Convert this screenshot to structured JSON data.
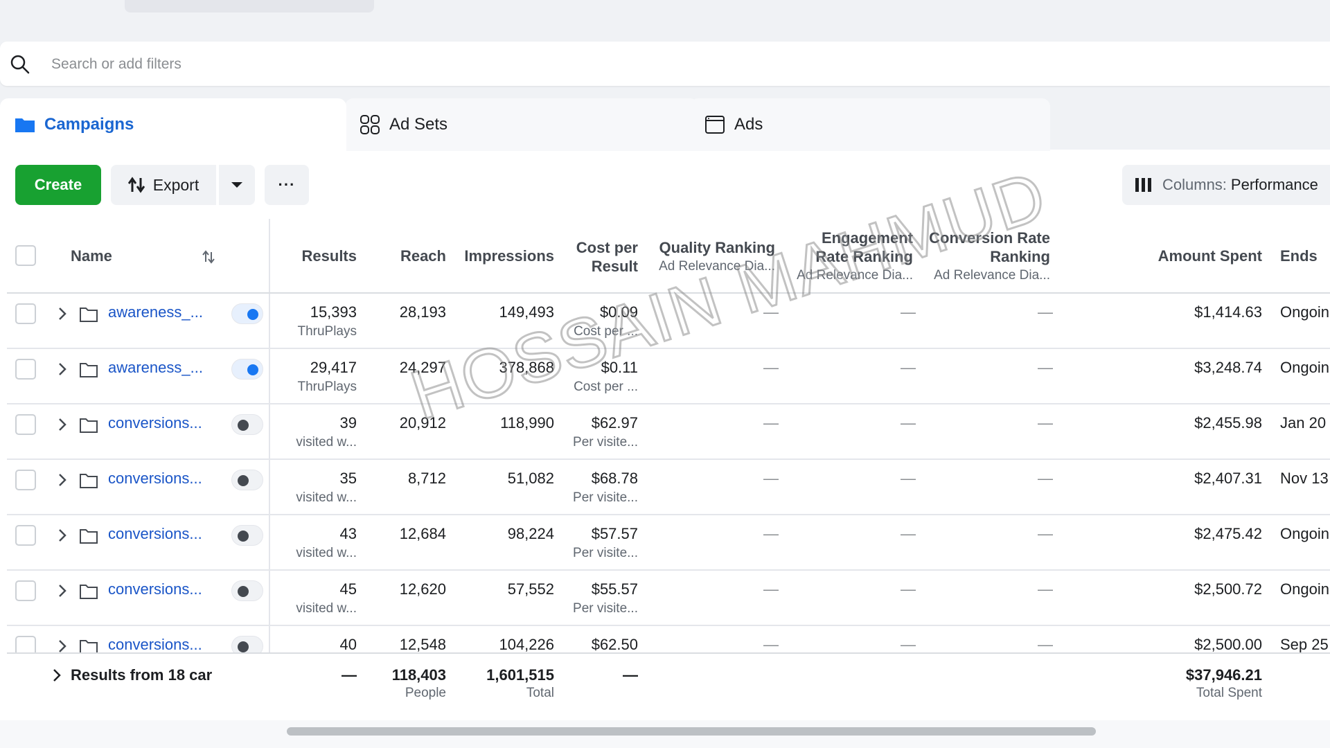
{
  "search": {
    "placeholder": "Search or add filters"
  },
  "tabs": [
    {
      "label": "Campaigns",
      "icon": "folder-icon"
    },
    {
      "label": "Ad Sets",
      "icon": "grid-icon"
    },
    {
      "label": "Ads",
      "icon": "ad-window-icon"
    }
  ],
  "toolbar": {
    "create_label": "Create",
    "export_label": "Export",
    "more_label": "···",
    "columns_label": "Columns:",
    "columns_value": "Performance"
  },
  "columns": {
    "name": "Name",
    "results": "Results",
    "reach": "Reach",
    "impressions": "Impressions",
    "cost_per_result": [
      "Cost per",
      "Result"
    ],
    "quality_ranking": "Quality Ranking",
    "quality_sub": "Ad Relevance Dia...",
    "engagement_ranking": [
      "Engagement",
      "Rate Ranking"
    ],
    "engagement_sub": "Ad Relevance Dia...",
    "conversion_ranking": [
      "Conversion Rate",
      "Ranking"
    ],
    "conversion_sub": "Ad Relevance Dia...",
    "amount_spent": "Amount Spent",
    "ends": "Ends"
  },
  "rows": [
    {
      "name": "awareness_...",
      "on": true,
      "results": "15,393",
      "results_sub": "ThruPlays",
      "reach": "28,193",
      "impressions": "149,493",
      "cost": "$0.09",
      "cost_sub": "Cost per ...",
      "quality": "—",
      "engagement": "—",
      "conversion": "—",
      "spent": "$1,414.63",
      "ends": "Ongoin"
    },
    {
      "name": "awareness_...",
      "on": true,
      "results": "29,417",
      "results_sub": "ThruPlays",
      "reach": "24,297",
      "impressions": "378,868",
      "cost": "$0.11",
      "cost_sub": "Cost per ...",
      "quality": "—",
      "engagement": "—",
      "conversion": "—",
      "spent": "$3,248.74",
      "ends": "Ongoin"
    },
    {
      "name": "conversions...",
      "on": false,
      "results": "39",
      "results_sub": "visited w...",
      "reach": "20,912",
      "impressions": "118,990",
      "cost": "$62.97",
      "cost_sub": "Per visite...",
      "quality": "—",
      "engagement": "—",
      "conversion": "—",
      "spent": "$2,455.98",
      "ends": "Jan 20"
    },
    {
      "name": "conversions...",
      "on": false,
      "results": "35",
      "results_sub": "visited w...",
      "reach": "8,712",
      "impressions": "51,082",
      "cost": "$68.78",
      "cost_sub": "Per visite...",
      "quality": "—",
      "engagement": "—",
      "conversion": "—",
      "spent": "$2,407.31",
      "ends": "Nov 13"
    },
    {
      "name": "conversions...",
      "on": false,
      "results": "43",
      "results_sub": "visited w...",
      "reach": "12,684",
      "impressions": "98,224",
      "cost": "$57.57",
      "cost_sub": "Per visite...",
      "quality": "—",
      "engagement": "—",
      "conversion": "—",
      "spent": "$2,475.42",
      "ends": "Ongoin"
    },
    {
      "name": "conversions...",
      "on": false,
      "results": "45",
      "results_sub": "visited w...",
      "reach": "12,620",
      "impressions": "57,552",
      "cost": "$55.57",
      "cost_sub": "Per visite...",
      "quality": "—",
      "engagement": "—",
      "conversion": "—",
      "spent": "$2,500.72",
      "ends": "Ongoin"
    },
    {
      "name": "conversions...",
      "on": false,
      "results": "40",
      "results_sub": "",
      "reach": "12,548",
      "impressions": "104,226",
      "cost": "$62.50",
      "cost_sub": "",
      "quality": "—",
      "engagement": "—",
      "conversion": "—",
      "spent": "$2,500.00",
      "ends": "Sep 25"
    }
  ],
  "summary": {
    "label": "Results from 18 car",
    "results": "—",
    "reach": "118,403",
    "reach_sub": "People",
    "impressions": "1,601,515",
    "impressions_sub": "Total",
    "cost": "—",
    "spent": "$37,946.21",
    "spent_sub": "Total Spent"
  },
  "watermark": "HOSSAIN MAHMUD",
  "colors": {
    "accent": "#1877f2",
    "create": "#18a131",
    "link": "#1a55c7"
  }
}
